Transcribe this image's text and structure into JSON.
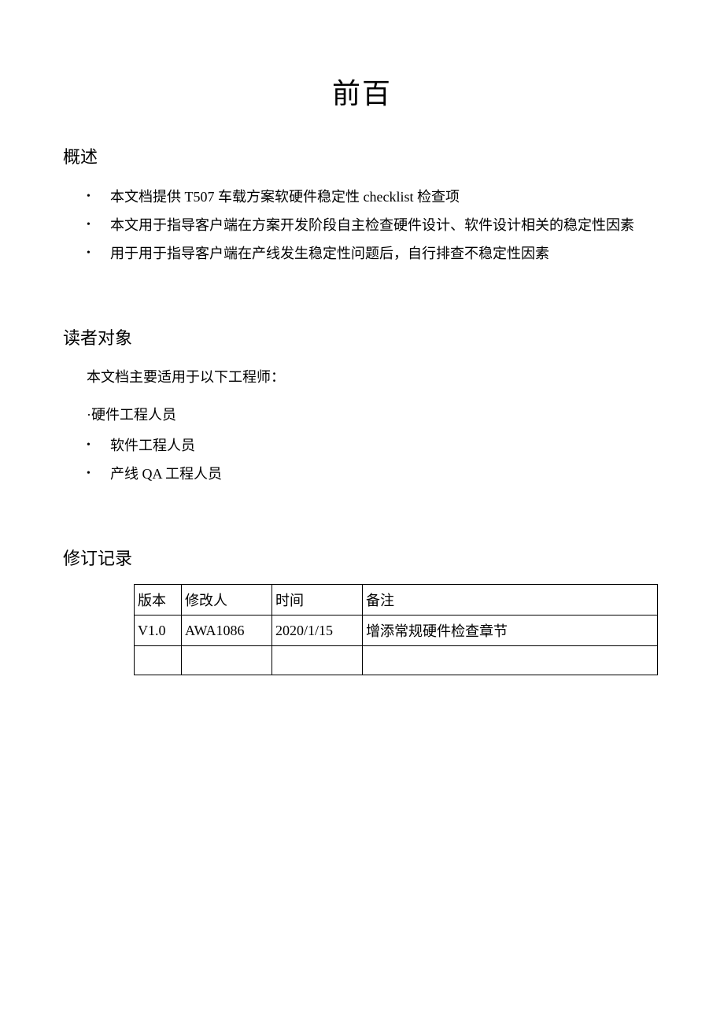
{
  "title": "前百",
  "overview": {
    "heading": "概述",
    "items": [
      "本文档提供 T507 车载方案软硬件稳定性 checklist 检查项",
      "本文用于指导客户端在方案开发阶段自主检查硬件设计、软件设计相关的稳定性因素",
      "用于用于指导客户端在产线发生稳定性问题后，自行排查不稳定性因素"
    ]
  },
  "audience": {
    "heading": "读者对象",
    "intro": "本文档主要适用于以下工程师：",
    "plain_item": "·硬件工程人员",
    "items": [
      "软件工程人员",
      "产线 QA 工程人员"
    ]
  },
  "revisions": {
    "heading": "修订记录",
    "headers": {
      "c1": "版本",
      "c2": "修改人",
      "c3": "时间",
      "c4": "备注"
    },
    "rows": [
      {
        "c1": "V1.0",
        "c2": "AWA1086",
        "c3": "2020/1/15",
        "c4": "增添常规硬件检查章节"
      },
      {
        "c1": "",
        "c2": "",
        "c3": "",
        "c4": ""
      }
    ]
  }
}
